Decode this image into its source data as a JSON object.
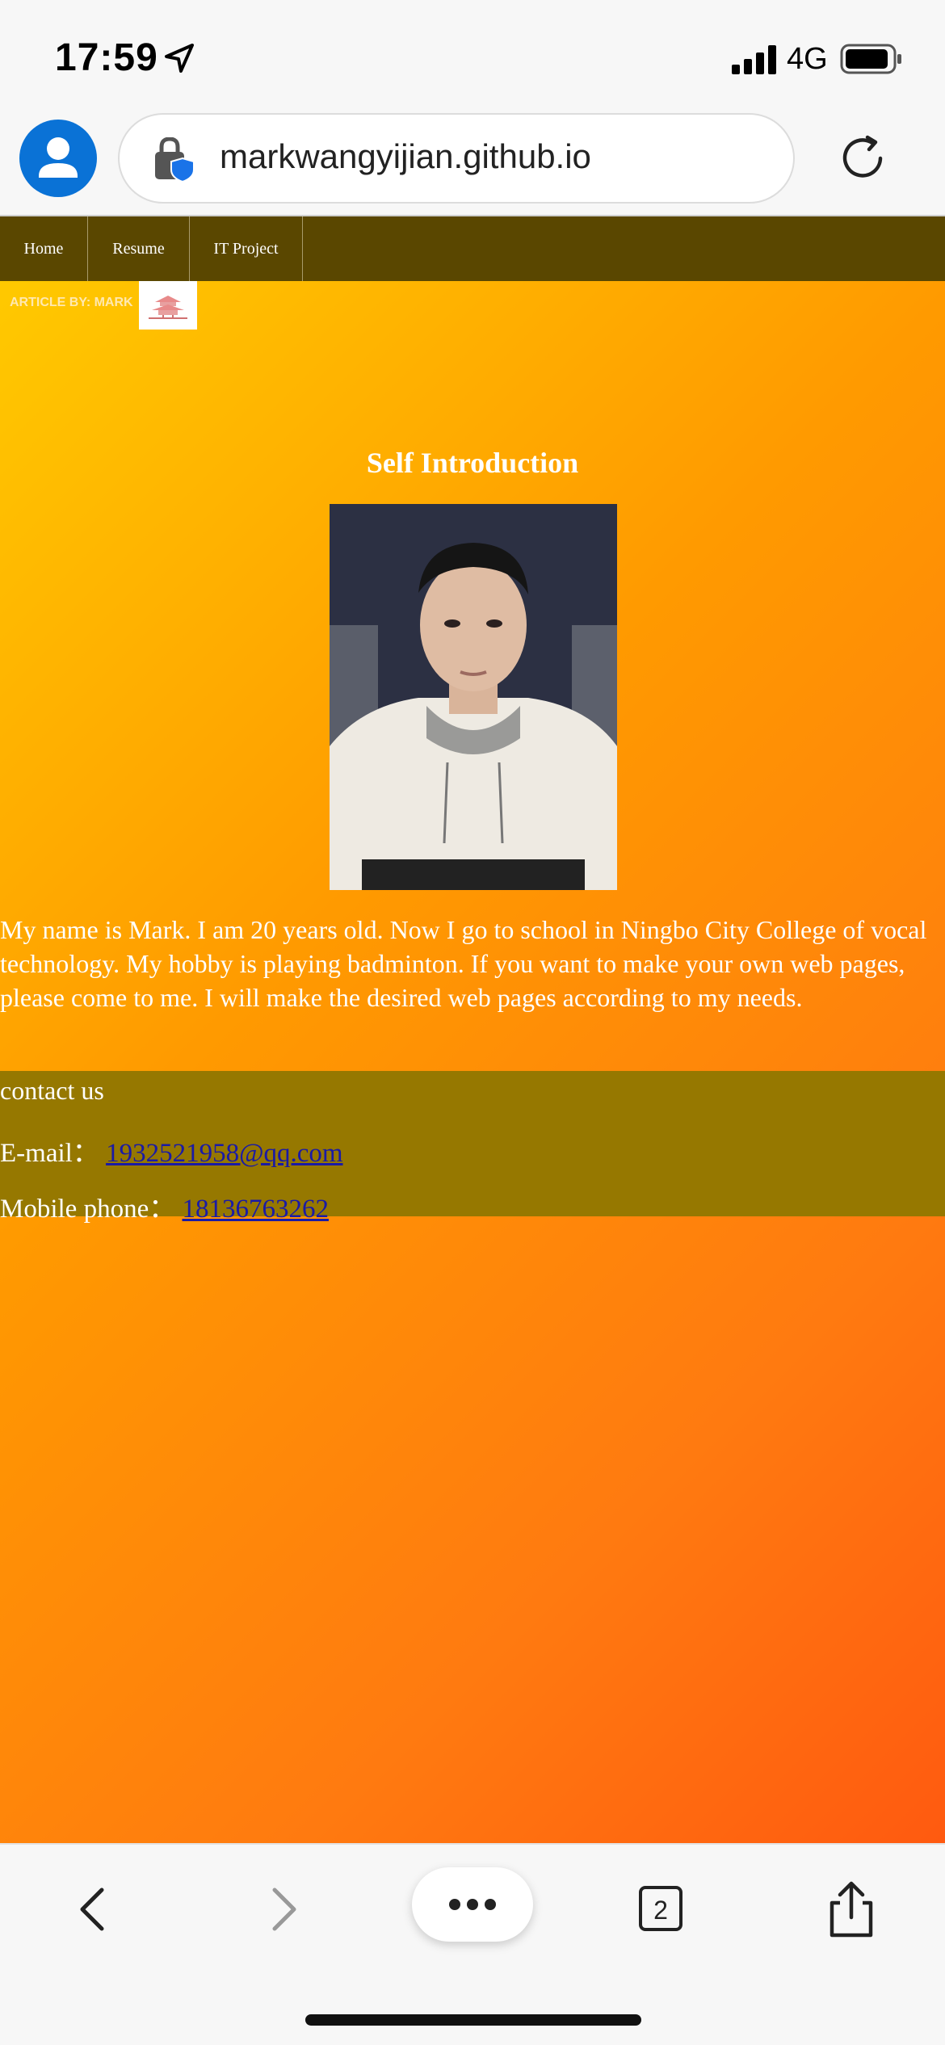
{
  "status_bar": {
    "time": "17:59",
    "network": "4G",
    "icons": [
      "location-arrow-icon",
      "signal-bars-icon",
      "battery-icon"
    ]
  },
  "browser": {
    "url": "markwangyijian.github.io",
    "tab_count": "2",
    "icons": [
      "profile-icon",
      "lock-shield-icon",
      "reload-icon",
      "back-icon",
      "forward-icon",
      "more-icon",
      "tabs-icon",
      "share-icon"
    ]
  },
  "site": {
    "nav": {
      "home": "Home",
      "resume": "Resume",
      "it_project": "IT Project"
    },
    "byline": "ARTICLE BY: MARK",
    "title": "Self Introduction",
    "intro": "My name is Mark. I am 20 years old. Now I go to school in Ningbo City College of vocal technology. My hobby is playing badminton. If you want to make your own web pages, please come to me. I will make the desired web pages according to my needs.",
    "contact": {
      "title": "contact us",
      "email_label": "E-mail：",
      "email": "1932521958@qq.com",
      "phone_label": "Mobile phone：",
      "phone": "18136763262"
    }
  },
  "colors": {
    "nav_bg": "#5a4700",
    "contact_bg": "#967800",
    "gradient_start": "#ffcc00",
    "gradient_end": "#ff5a10",
    "link": "#1a1aa6",
    "browser_accent": "#0a72d6"
  }
}
